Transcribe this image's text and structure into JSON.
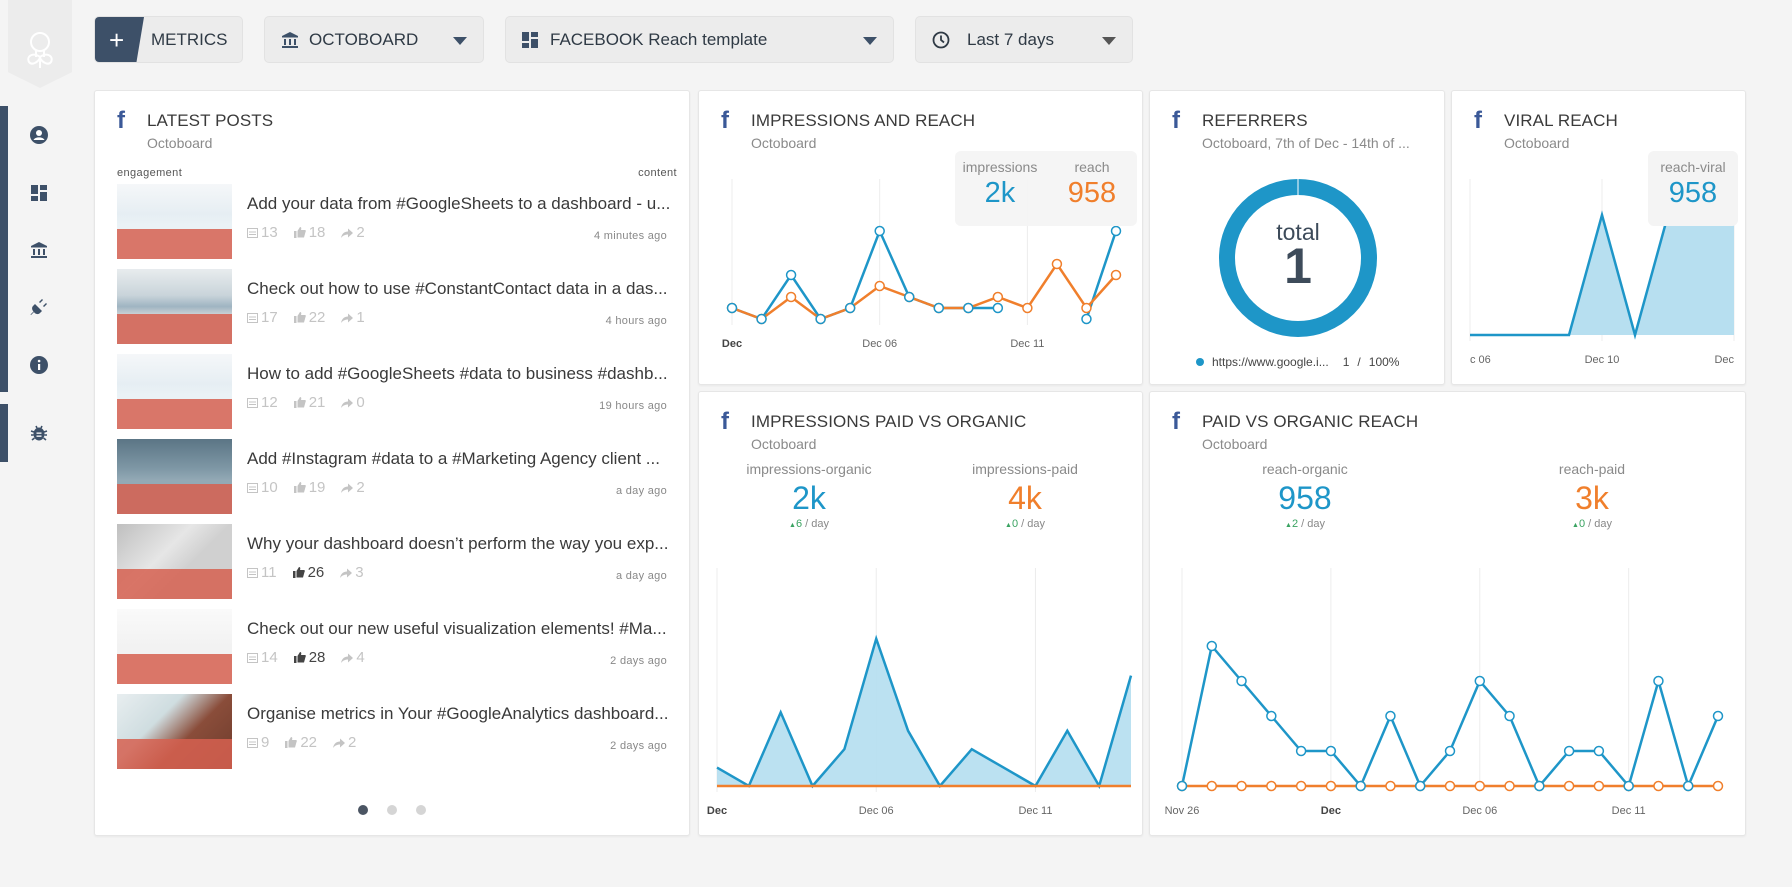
{
  "colors": {
    "blue": "#1e96c8",
    "orange": "#f07f2c",
    "navy": "#3d5068",
    "facebook": "#3b5998",
    "fill": "#b7dff0"
  },
  "sidebar": {
    "items": [
      {
        "name": "account",
        "icon": "user-circle-icon"
      },
      {
        "name": "dashboards",
        "icon": "dashboard-icon"
      },
      {
        "name": "organizations",
        "icon": "bank-icon"
      },
      {
        "name": "integrations",
        "icon": "plug-icon"
      },
      {
        "name": "info",
        "icon": "info-icon"
      },
      {
        "name": "bug-report",
        "icon": "bug-icon"
      }
    ]
  },
  "toolbar": {
    "metrics_label": "METRICS",
    "plus_label": "+",
    "organization": "OCTOBOARD",
    "dashboard": "FACEBOOK Reach template",
    "date_range": "Last 7 days"
  },
  "latest_posts": {
    "title": "LATEST POSTS",
    "subtitle": "Octoboard",
    "col_engagement": "engagement",
    "col_content": "content",
    "posts": [
      {
        "text": "Add your data from #GoogleSheets to a dashboard - u...",
        "comments": "13",
        "likes": "18",
        "shares": "2",
        "time": "4 minutes ago",
        "likes_highlight": false
      },
      {
        "text": "Check out how to use #ConstantContact data in a das...",
        "comments": "17",
        "likes": "22",
        "shares": "1",
        "time": "4 hours ago",
        "likes_highlight": false
      },
      {
        "text": "How to add #GoogleSheets #data to business #dashb...",
        "comments": "12",
        "likes": "21",
        "shares": "0",
        "time": "19 hours ago",
        "likes_highlight": false
      },
      {
        "text": "Add #Instagram #data to a #Marketing Agency client ...",
        "comments": "10",
        "likes": "19",
        "shares": "2",
        "time": "a day ago",
        "likes_highlight": false
      },
      {
        "text": "Why your dashboard doesn’t perform the way you exp...",
        "comments": "11",
        "likes": "26",
        "shares": "3",
        "time": "a day ago",
        "likes_highlight": true
      },
      {
        "text": "Check out our new useful visualization elements! #Ma...",
        "comments": "14",
        "likes": "28",
        "shares": "4",
        "time": "2 days ago",
        "likes_highlight": true
      },
      {
        "text": "Organise metrics in Your #GoogleAnalytics dashboard...",
        "comments": "9",
        "likes": "22",
        "shares": "2",
        "time": "2 days ago",
        "likes_highlight": false
      }
    ],
    "pagination": {
      "pages": 3,
      "current": 1
    }
  },
  "impressions_reach": {
    "title": "IMPRESSIONS AND REACH",
    "subtitle": "Octoboard",
    "impressions_label": "impressions",
    "impressions_value": "2k",
    "reach_label": "reach",
    "reach_value": "958"
  },
  "referrers": {
    "title": "REFERRERS",
    "subtitle": "Octoboard, 7th of Dec - 14th of ...",
    "total_label": "total",
    "total_value": "1",
    "legend": [
      {
        "label": "https://www.google.i...",
        "count": "1",
        "sep": "/",
        "percent": "100%"
      }
    ]
  },
  "viral_reach": {
    "title": "VIRAL REACH",
    "subtitle": "Octoboard",
    "label": "reach-viral",
    "value": "958"
  },
  "impressions_paid_organic": {
    "title": "IMPRESSIONS PAID VS ORGANIC",
    "subtitle": "Octoboard",
    "organic_label": "impressions-organic",
    "organic_value": "2k",
    "organic_delta": "6",
    "paid_label": "impressions-paid",
    "paid_value": "4k",
    "paid_delta": "0",
    "per_day": " / day",
    "up_arrow": "▲"
  },
  "paid_organic_reach": {
    "title": "PAID VS ORGANIC REACH",
    "subtitle": "Octoboard",
    "organic_label": "reach-organic",
    "organic_value": "958",
    "organic_delta": "2",
    "paid_label": "reach-paid",
    "paid_value": "3k",
    "paid_delta": "0",
    "per_day": " / day",
    "up_arrow": "▲"
  },
  "chart_data": [
    {
      "id": "impressions_reach",
      "type": "line",
      "title": "IMPRESSIONS AND REACH",
      "x": [
        "Dec 01",
        "Dec 02",
        "Dec 03",
        "Dec 04",
        "Dec 05",
        "Dec 06",
        "Dec 07",
        "Dec 08",
        "Dec 09",
        "Dec 10",
        "Dec 11",
        "Dec 12",
        "Dec 13",
        "Dec 14"
      ],
      "x_ticks": [
        {
          "index": 0,
          "label": "Dec",
          "bold": true
        },
        {
          "index": 5,
          "label": "Dec 06"
        },
        {
          "index": 10,
          "label": "Dec 11"
        }
      ],
      "series": [
        {
          "name": "impressions",
          "color": "#1e96c8",
          "values": [
            1,
            0,
            4,
            0,
            1,
            8,
            2,
            1,
            1,
            1,
            null,
            null,
            0,
            8
          ]
        },
        {
          "name": "reach",
          "color": "#f07f2c",
          "values": [
            1,
            0,
            2,
            0,
            1,
            3,
            2,
            1,
            1,
            2,
            1,
            5,
            1,
            4
          ]
        }
      ],
      "ylim": [
        0,
        10
      ],
      "grid": "vertical"
    },
    {
      "id": "referrers",
      "type": "pie",
      "title": "REFERRERS",
      "categories": [
        "https://www.google.i..."
      ],
      "values": [
        1
      ],
      "colors": [
        "#1e96c8"
      ],
      "donut": true
    },
    {
      "id": "viral_reach",
      "type": "area",
      "title": "VIRAL REACH",
      "x": [
        "Dec 06",
        "Dec 07",
        "Dec 08",
        "Dec 09",
        "Dec 10",
        "Dec 11",
        "Dec 12",
        "Dec 13",
        "Dec 14"
      ],
      "x_ticks": [
        {
          "index": 0,
          "label": "c 06"
        },
        {
          "index": 4,
          "label": "Dec 10"
        },
        {
          "index": 8,
          "label": "Dec"
        }
      ],
      "series": [
        {
          "name": "reach-viral",
          "color": "#1e96c8",
          "values": [
            0,
            0,
            0,
            0,
            1,
            0,
            1,
            1,
            1
          ]
        }
      ],
      "ylim": [
        0,
        1.3
      ],
      "grid": "vertical"
    },
    {
      "id": "impressions_paid_organic",
      "type": "area",
      "title": "IMPRESSIONS PAID VS ORGANIC",
      "x": [
        "Dec 01",
        "Dec 02",
        "Dec 03",
        "Dec 04",
        "Dec 05",
        "Dec 06",
        "Dec 07",
        "Dec 08",
        "Dec 09",
        "Dec 10",
        "Dec 11",
        "Dec 12",
        "Dec 13",
        "Dec 14"
      ],
      "x_ticks": [
        {
          "index": 0,
          "label": "Dec",
          "bold": true
        },
        {
          "index": 5,
          "label": "Dec 06"
        },
        {
          "index": 10,
          "label": "Dec 11"
        }
      ],
      "series": [
        {
          "name": "impressions-organic",
          "color": "#1e96c8",
          "values": [
            1,
            0,
            4,
            0,
            2,
            8,
            3,
            0,
            2,
            1,
            0,
            3,
            0,
            6
          ]
        },
        {
          "name": "impressions-paid",
          "color": "#f07f2c",
          "values": [
            0,
            0,
            0,
            0,
            0,
            0,
            0,
            0,
            0,
            0,
            0,
            0,
            0,
            0
          ]
        }
      ],
      "ylim": [
        0,
        10
      ],
      "grid": "vertical"
    },
    {
      "id": "paid_organic_reach",
      "type": "line",
      "title": "PAID VS ORGANIC REACH",
      "x": [
        "Nov 26",
        "Nov 27",
        "Nov 28",
        "Nov 29",
        "Nov 30",
        "Dec 01",
        "Dec 02",
        "Dec 03",
        "Dec 04",
        "Dec 05",
        "Dec 06",
        "Dec 07",
        "Dec 08",
        "Dec 09",
        "Dec 10",
        "Dec 11",
        "Dec 12",
        "Dec 13",
        "Dec 14"
      ],
      "x_ticks": [
        {
          "index": 0,
          "label": "Nov 26"
        },
        {
          "index": 5,
          "label": "Dec",
          "bold": true
        },
        {
          "index": 10,
          "label": "Dec 06"
        },
        {
          "index": 15,
          "label": "Dec 11"
        }
      ],
      "series": [
        {
          "name": "reach-organic",
          "color": "#1e96c8",
          "values": [
            0,
            8,
            6,
            4,
            2,
            2,
            0,
            4,
            0,
            2,
            6,
            4,
            0,
            2,
            2,
            0,
            6,
            0,
            4
          ]
        },
        {
          "name": "reach-paid",
          "color": "#f07f2c",
          "values": [
            0,
            0,
            0,
            0,
            0,
            0,
            0,
            0,
            0,
            0,
            0,
            0,
            0,
            0,
            0,
            0,
            0,
            0,
            0
          ]
        }
      ],
      "ylim": [
        0,
        10
      ],
      "grid": "vertical"
    }
  ]
}
